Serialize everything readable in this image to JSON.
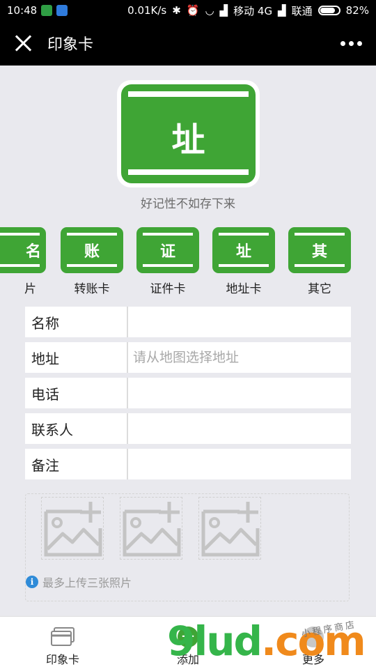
{
  "status_bar": {
    "time": "10:48",
    "network_speed": "0.01K/s",
    "carrier1": "移动 4G",
    "carrier2": "联通",
    "battery": "82%",
    "battery_level": 0.82
  },
  "nav": {
    "title": "印象卡"
  },
  "hero": {
    "char": "址",
    "caption": "好记性不如存下来"
  },
  "card_types": [
    {
      "char": "名",
      "label": "片"
    },
    {
      "char": "账",
      "label": "转账卡"
    },
    {
      "char": "证",
      "label": "证件卡"
    },
    {
      "char": "址",
      "label": "地址卡"
    },
    {
      "char": "其",
      "label": "其它"
    }
  ],
  "form": {
    "rows": [
      {
        "label": "名称",
        "value": "",
        "placeholder": ""
      },
      {
        "label": "地址",
        "value": "",
        "placeholder": "请从地图选择地址"
      },
      {
        "label": "电话",
        "value": "",
        "placeholder": ""
      },
      {
        "label": "联系人",
        "value": "",
        "placeholder": ""
      },
      {
        "label": "备注",
        "value": "",
        "placeholder": ""
      }
    ]
  },
  "photos": {
    "hint": "最多上传三张照片"
  },
  "tab_bar": {
    "tabs": [
      {
        "label": "印象卡",
        "icon": "cards-icon"
      },
      {
        "label": "添加",
        "icon": "plus-icon"
      },
      {
        "label": "更多",
        "icon": "more-icon"
      }
    ]
  },
  "watermark": {
    "logo": "9lud.com",
    "tagline": "小程序商店"
  },
  "colors": {
    "brand_green": "#3fa535",
    "info_blue": "#2f8bd8",
    "background": "#e9e9ee"
  }
}
